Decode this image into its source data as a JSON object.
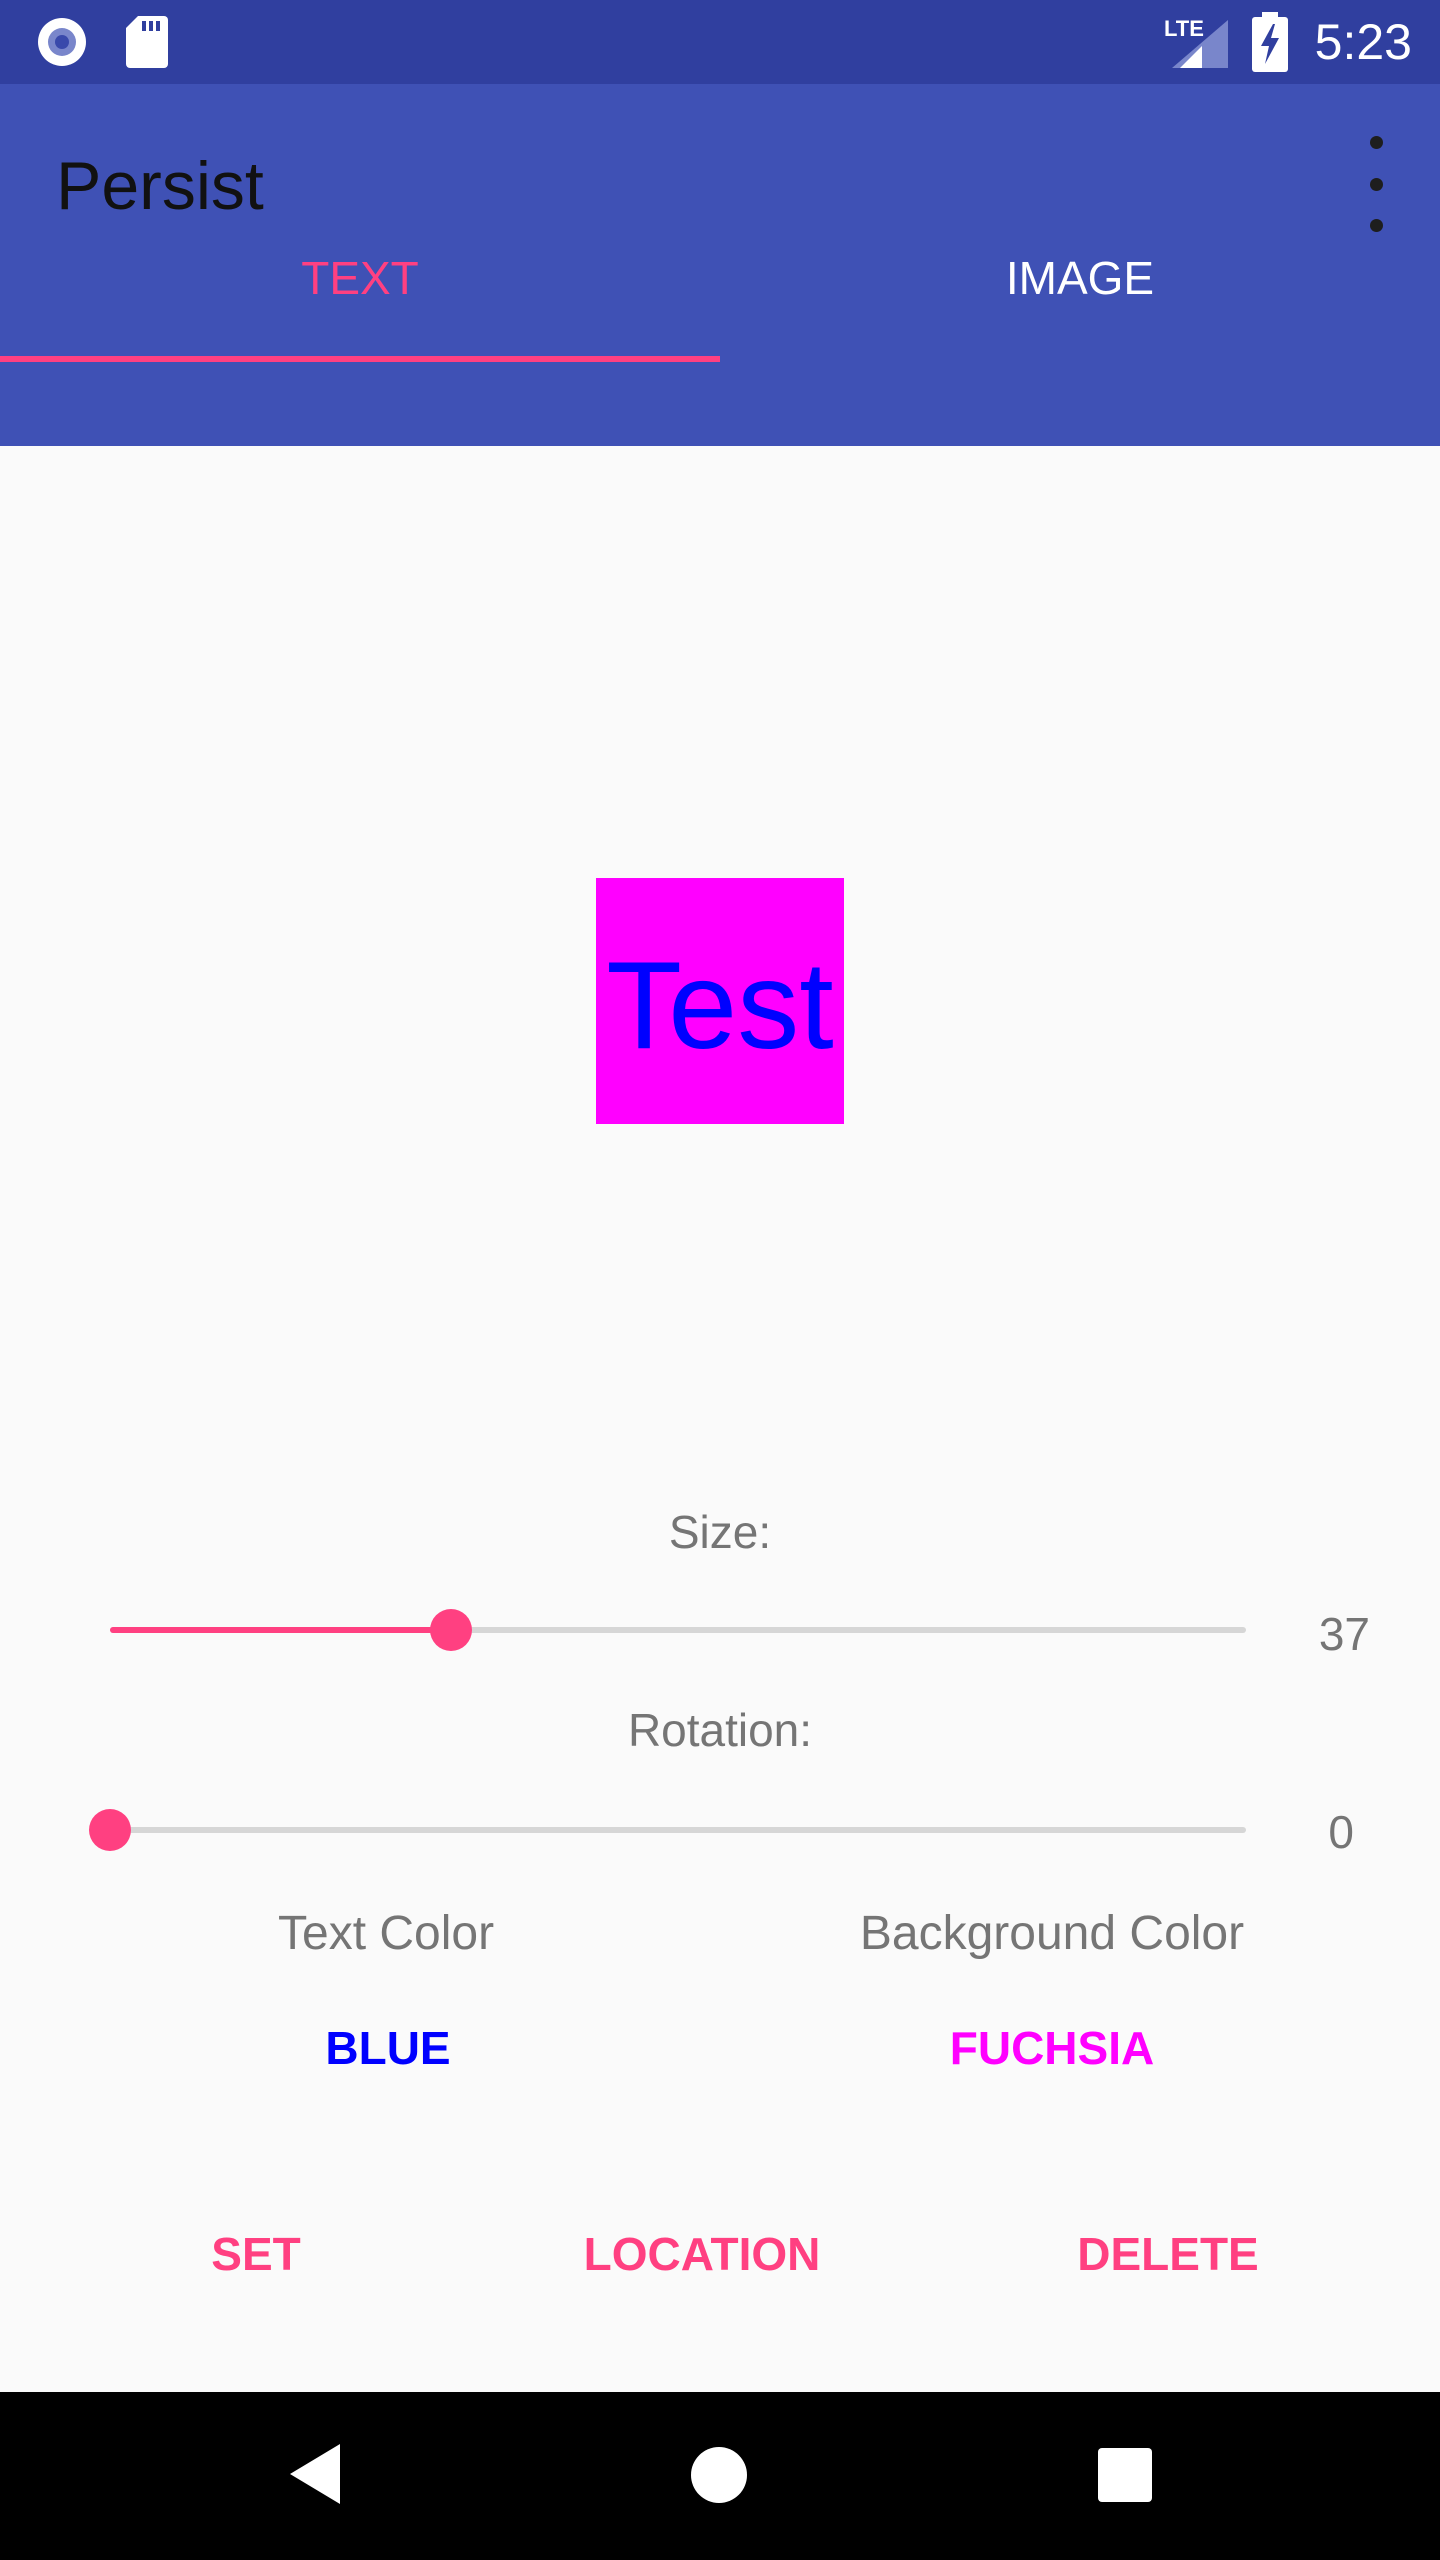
{
  "status_bar": {
    "time": "5:23",
    "network": "LTE"
  },
  "app_bar": {
    "title": "Persist"
  },
  "tabs": [
    {
      "label": "TEXT",
      "selected": true
    },
    {
      "label": "IMAGE",
      "selected": false
    }
  ],
  "preview": {
    "text": "Test",
    "text_color": "#0000ff",
    "background_color": "#ff00ff"
  },
  "size": {
    "label": "Size:",
    "value": "37",
    "fraction": 0.3
  },
  "rotation": {
    "label": "Rotation:",
    "value": "0",
    "fraction": 0
  },
  "colors": {
    "text_color_label": "Text Color",
    "text_color_value": "BLUE",
    "text_color_hex": "#0000ff",
    "background_color_label": "Background Color",
    "background_color_value": "FUCHSIA",
    "background_color_hex": "#ff00ff"
  },
  "actions": {
    "set": "SET",
    "location": "LOCATION",
    "delete": "DELETE"
  },
  "theme": {
    "primary": "#3f51b5",
    "primary_dark": "#303f9f",
    "accent": "#ff4081"
  },
  "icons": {
    "status_left": [
      "radio-icon",
      "sd-card-icon"
    ],
    "status_right": [
      "lte-signal-icon",
      "battery-charging-icon"
    ],
    "nav": [
      "back-icon",
      "home-icon",
      "recents-icon"
    ]
  }
}
